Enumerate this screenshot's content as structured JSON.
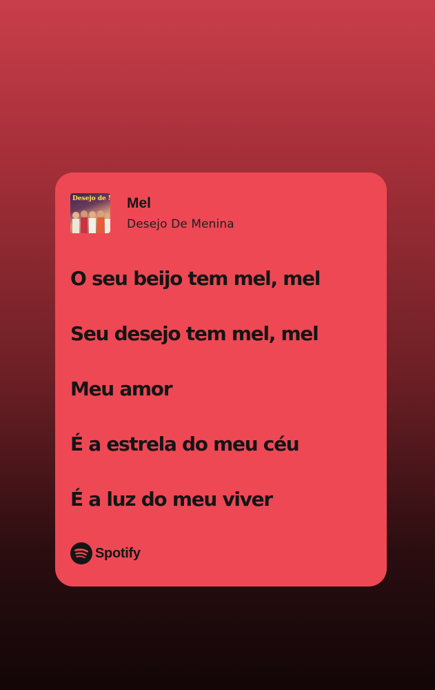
{
  "track": {
    "title": "Mel",
    "artist": "Desejo De Menina",
    "album_art_text": "Desejo de Menina"
  },
  "lyrics": [
    "O seu beijo tem mel, mel",
    "Seu desejo tem mel, mel",
    "Meu amor",
    "É a estrela do meu céu",
    "É a luz do meu viver"
  ],
  "brand": {
    "icon": "spotify-icon",
    "name": "Spotify"
  },
  "colors": {
    "card_background": "#ee4855",
    "text": "#151515",
    "gradient_top": "#c93e4a",
    "gradient_bottom": "#120607"
  }
}
